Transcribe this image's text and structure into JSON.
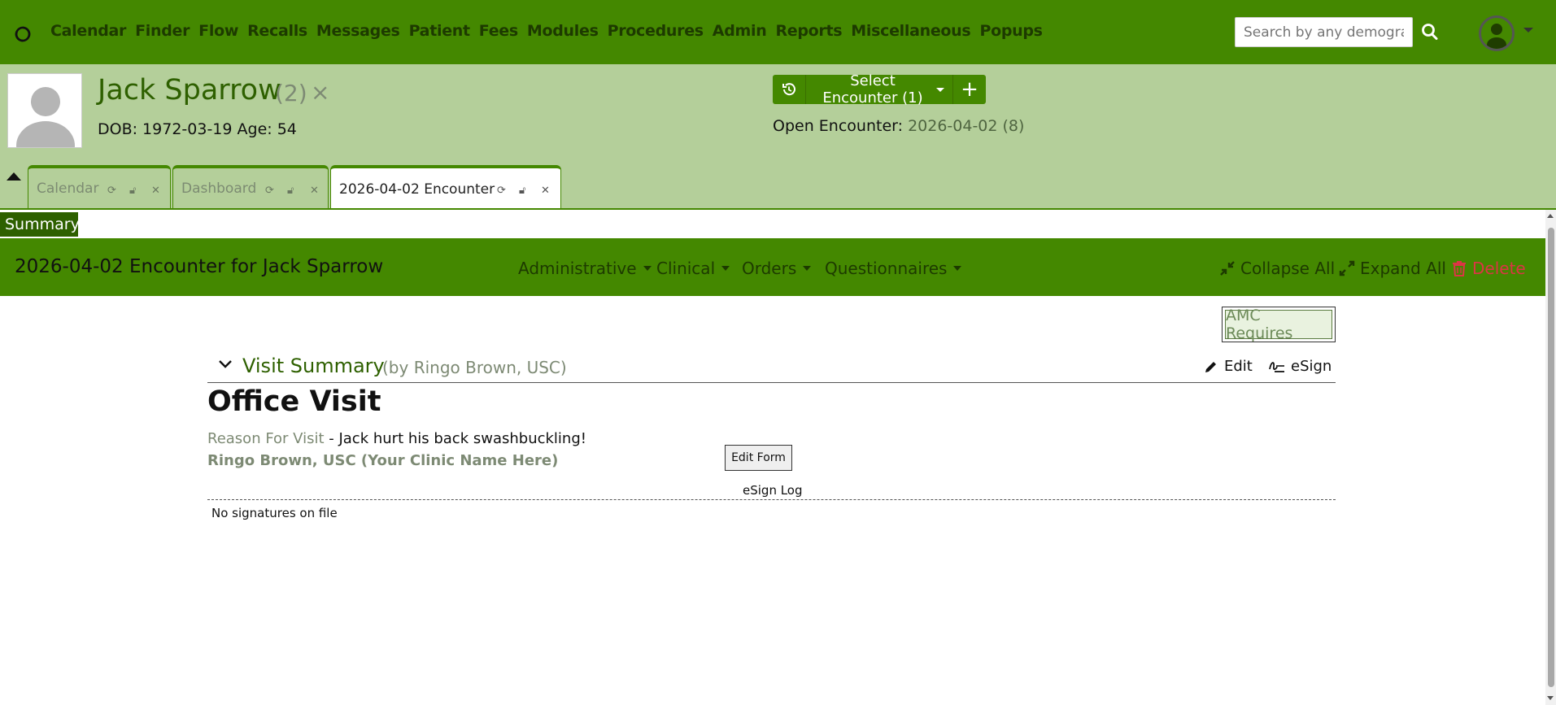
{
  "nav": {
    "menu": [
      "Calendar",
      "Finder",
      "Flow",
      "Recalls",
      "Messages",
      "Patient",
      "Fees",
      "Modules",
      "Procedures",
      "Admin",
      "Reports",
      "Miscellaneous",
      "Popups"
    ],
    "search_placeholder": "Search by any demographics",
    "search_icon": "search-icon",
    "avatar_icon": "user-avatar-icon"
  },
  "patient": {
    "name": "Jack Sparrow",
    "pid": "(2)",
    "close": "×",
    "dob_line": "DOB: 1972-03-19 Age: 54",
    "select_encounter": "Select Encounter  (1)",
    "add": "+",
    "open_encounter_label": "Open Encounter:",
    "open_encounter_value": "2026-04-02 (8)"
  },
  "tabs": [
    {
      "label": "Calendar",
      "active": false
    },
    {
      "label": "Dashboard",
      "active": false
    },
    {
      "label": "2026-04-02 Encounter",
      "active": true
    }
  ],
  "summary_tag": "Summary",
  "encounter": {
    "title": "2026-04-02 Encounter for Jack Sparrow",
    "menus": [
      "Administrative",
      "Clinical",
      "Orders",
      "Questionnaires"
    ],
    "collapse_all": "Collapse All",
    "expand_all": "Expand All",
    "delete": "Delete"
  },
  "content": {
    "amc": "AMC Requires",
    "visit_summary": "Visit Summary",
    "visit_by": "(by Ringo Brown, USC)",
    "edit": "Edit",
    "esign": "eSign",
    "form_title": "Office Visit",
    "reason_label": "Reason For Visit",
    "reason_text": " - Jack hurt his back swashbuckling!",
    "provider": "Ringo Brown, USC (Your Clinic Name Here)",
    "edit_form": "Edit Form",
    "esign_log": "eSign Log",
    "no_signatures": "No signatures on file"
  },
  "colors": {
    "nav_green": "#448800",
    "header_light_green": "#b4cf9a",
    "dark_green": "#2e6000",
    "delete_red": "#dc3545"
  }
}
